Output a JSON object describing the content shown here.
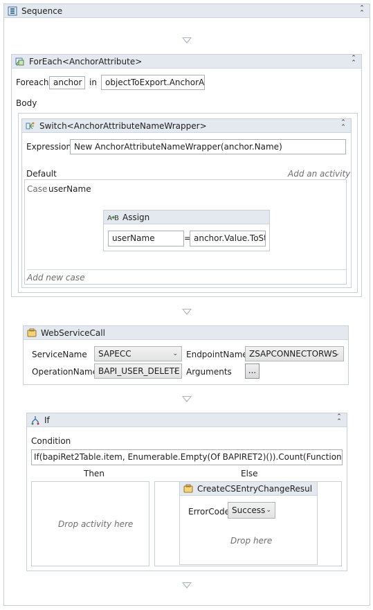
{
  "sequence": {
    "title": "Sequence"
  },
  "foreach": {
    "title": "ForEach<AnchorAttribute>",
    "foreach_label": "Foreach",
    "item_value": "anchor",
    "in_label": "in",
    "collection_value": "objectToExport.AnchorAttr",
    "body_label": "Body"
  },
  "switch": {
    "title": "Switch<AnchorAttributeNameWrapper>",
    "expression_label": "Expression",
    "expression_value": "New AnchorAttributeNameWrapper(anchor.Name)",
    "default_label": "Default",
    "add_activity": "Add an activity",
    "case_label": "Case",
    "case_value": "userName",
    "add_new_case": "Add new case"
  },
  "assign": {
    "title": "Assign",
    "to_value": "userName",
    "equals": "=",
    "value": "anchor.Value.ToStri"
  },
  "webservice": {
    "title": "WebServiceCall",
    "service_name_label": "ServiceName",
    "service_name_value": "SAPECC",
    "endpoint_label": "EndpointName",
    "endpoint_value": "ZSAPCONNECTORWS",
    "operation_label": "OperationName",
    "operation_value": "BAPI_USER_DELETE",
    "arguments_label": "Arguments",
    "arguments_button": "..."
  },
  "if_activity": {
    "title": "If",
    "condition_label": "Condition",
    "condition_value": "If(bapiRet2Table.item, Enumerable.Empty(Of BAPIRET2)()).Count(Function(errItem)",
    "then_label": "Then",
    "else_label": "Else",
    "drop_activity": "Drop activity here"
  },
  "create_entry": {
    "title": "CreateCSEntryChangeResul",
    "error_code_label": "ErrorCode",
    "error_code_value": "Success",
    "drop_here": "Drop here"
  }
}
